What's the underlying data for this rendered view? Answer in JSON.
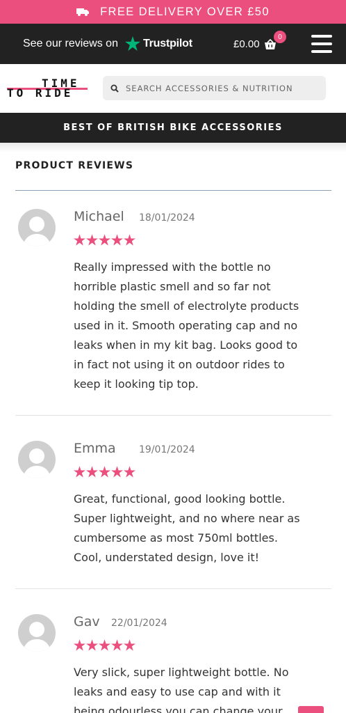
{
  "promo": {
    "text": "FREE DELIVERY OVER £50",
    "icon": "truck-icon"
  },
  "topbar": {
    "reviews_text": "See our reviews on",
    "trustpilot_brand": "Trustpilot",
    "cart_total": "£0.00",
    "cart_count": "0"
  },
  "header": {
    "logo_line1": "TIME",
    "logo_line2": "TO RIDE",
    "search_placeholder": "SEARCH ACCESSORIES & NUTRITION"
  },
  "subbar": {
    "text": "BEST OF BRITISH BIKE ACCESSORIES"
  },
  "section": {
    "title": "PRODUCT REVIEWS"
  },
  "reviews": [
    {
      "name": "Michael",
      "date": "18/01/2024",
      "rating": 5,
      "lines": [
        "Really impressed with the bottle no",
        "horrible plastic smell and so far not",
        "holding the smell of electrolyte products",
        "used in it. Smooth operating cap and no",
        "leaks when in my kit bag. Looks good to",
        "in fact not using it on outdoor rides to",
        "keep it looking tip top."
      ]
    },
    {
      "name": "Emma",
      "date": "19/01/2024",
      "rating": 5,
      "lines": [
        "Great, functional, good looking bottle.",
        "Super lightweight, and no where near as",
        "cumbersome as most 750ml bottles.",
        "Cool, understated design, love it!"
      ]
    },
    {
      "name": "Gav",
      "date": "22/01/2024",
      "rating": 5,
      "lines": [
        "Very slick, super lightweight bottle. No",
        "leaks and easy to use cap and with it",
        "being odourless you can change your"
      ]
    }
  ],
  "colors": {
    "accent": "#ea4f7e",
    "dark": "#222222",
    "trustpilot_green": "#00b67a",
    "star": "#ea4f7e"
  }
}
